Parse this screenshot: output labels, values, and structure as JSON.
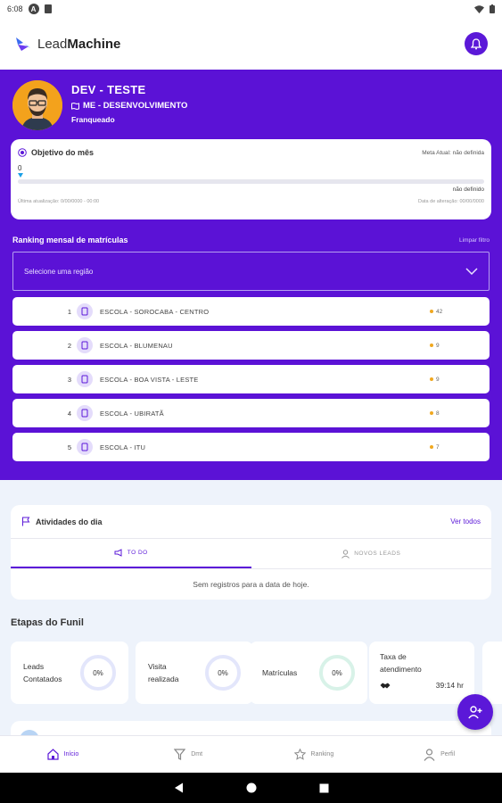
{
  "status_bar": {
    "time": "6:08"
  },
  "app": {
    "logo_light": "Lead",
    "logo_bold": "Machine"
  },
  "profile": {
    "name": "DEV - TESTE",
    "unit": "ME - DESENVOLVIMENTO",
    "role": "Franqueado"
  },
  "goal": {
    "title": "Objetivo do mês",
    "meta_label": "Meta Atual: não definida",
    "current_value": "0",
    "status": "não definido",
    "last_update": "Última atualização: 0/00/0000 - 00:00",
    "updated_at": "Data de alteração: 00/00/0000"
  },
  "ranking": {
    "title": "Ranking mensal de matrículas",
    "clear_filter": "Limpar filtro",
    "region_placeholder": "Selecione uma região",
    "rows": [
      {
        "position": "1",
        "name": "ESCOLA - SOROCABA - CENTRO",
        "score": "42"
      },
      {
        "position": "2",
        "name": "ESCOLA - BLUMENAU",
        "score": "9"
      },
      {
        "position": "3",
        "name": "ESCOLA - BOA VISTA - LESTE",
        "score": "9"
      },
      {
        "position": "4",
        "name": "ESCOLA - UBIRATÃ",
        "score": "8"
      },
      {
        "position": "5",
        "name": "ESCOLA - ITU",
        "score": "7"
      }
    ]
  },
  "activities": {
    "title": "Atividades do dia",
    "see_all": "Ver todos",
    "tab_todo": "TO DO",
    "tab_new_leads": "NOVOS LEADS",
    "empty_message": "Sem registros para a data de hoje."
  },
  "funnel": {
    "title": "Etapas do Funil",
    "stages": [
      {
        "label_line1": "Leads",
        "label_line2": "Contatados",
        "value": "0%"
      },
      {
        "label_line1": "Visita",
        "label_line2": "realizada",
        "value": "0%"
      },
      {
        "label_line1": "Matrículas",
        "label_line2": "",
        "value": "0%"
      }
    ],
    "rate": {
      "label_line1": "Taxa de",
      "label_line2": "atendimento",
      "value": "39:14 hr"
    }
  },
  "bottom_nav": {
    "home": "Início",
    "dmt": "Dmt",
    "ranking": "Ranking",
    "profile": "Perfil"
  },
  "colors": {
    "primary": "#5b12d6",
    "accent_blue": "#1aa0e6",
    "score_dot": "#f0a820"
  }
}
